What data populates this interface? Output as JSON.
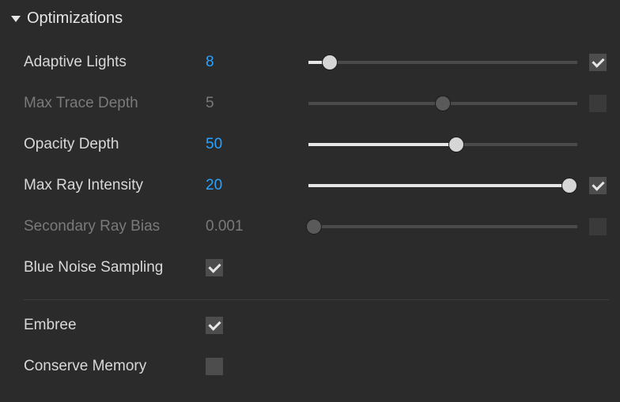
{
  "section": {
    "title": "Optimizations"
  },
  "rows": {
    "adaptive_lights": {
      "label": "Adaptive Lights",
      "value": "8",
      "percent": 8,
      "checked": true,
      "disabled": false,
      "active": true,
      "hasSlider": true,
      "hasCheck": true
    },
    "max_trace_depth": {
      "label": "Max Trace Depth",
      "value": "5",
      "percent": 50,
      "checked": false,
      "disabled": true,
      "active": false,
      "hasSlider": true,
      "hasCheck": true
    },
    "opacity_depth": {
      "label": "Opacity Depth",
      "value": "50",
      "percent": 55,
      "checked": null,
      "disabled": false,
      "active": true,
      "hasSlider": true,
      "hasCheck": false
    },
    "max_ray_intensity": {
      "label": "Max Ray Intensity",
      "value": "20",
      "percent": 97,
      "checked": true,
      "disabled": false,
      "active": true,
      "hasSlider": true,
      "hasCheck": true
    },
    "secondary_ray_bias": {
      "label": "Secondary Ray Bias",
      "value": "0.001",
      "percent": 2,
      "checked": false,
      "disabled": true,
      "active": false,
      "hasSlider": true,
      "hasCheck": true
    },
    "blue_noise": {
      "label": "Blue Noise Sampling",
      "value": "",
      "percent": 0,
      "checked": true,
      "disabled": false,
      "active": false,
      "hasSlider": false,
      "hasCheck": true
    },
    "embree": {
      "label": "Embree",
      "value": "",
      "percent": 0,
      "checked": true,
      "disabled": false,
      "active": false,
      "hasSlider": false,
      "hasCheck": true
    },
    "conserve_memory": {
      "label": "Conserve Memory",
      "value": "",
      "percent": 0,
      "checked": false,
      "disabled": false,
      "active": false,
      "hasSlider": false,
      "hasCheck": true
    }
  }
}
